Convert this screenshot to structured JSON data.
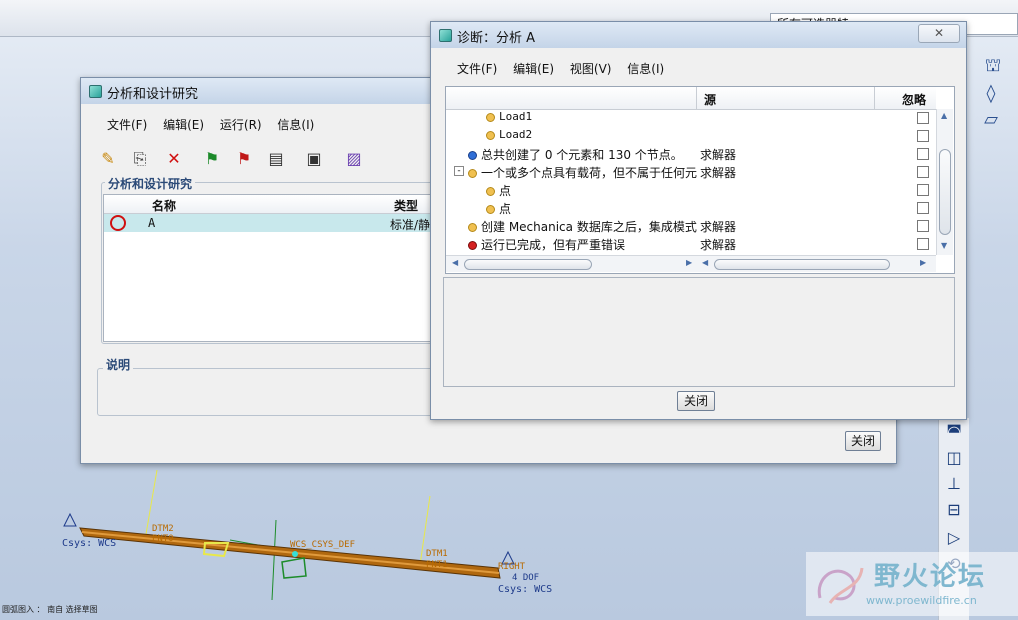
{
  "toolbar": {
    "filter_text": "所有可选器特"
  },
  "analysis_window": {
    "title": "分析和设计研究",
    "menu": [
      "文件(F)",
      "编辑(E)",
      "运行(R)",
      "信息(I)"
    ],
    "group_title": "分析和设计研究",
    "columns": {
      "name": "名称",
      "type": "类型"
    },
    "row": {
      "name": "A",
      "type": "标准/静"
    },
    "desc_title": "说明",
    "close_label": "关闭"
  },
  "diag_window": {
    "title": "诊断：分析 A",
    "close_x": "✕",
    "menu": [
      "文件(F)",
      "编辑(E)",
      "视图(V)",
      "信息(I)"
    ],
    "columns": {
      "source": "源",
      "ignore": "忽略"
    },
    "rows": [
      {
        "text": "Load1",
        "source": ""
      },
      {
        "text": "Load2",
        "source": ""
      },
      {
        "text": "总共创建了 0 个元素和 130 个节点。",
        "source": "求解器"
      },
      {
        "text": "一个或多个点具有载荷，但不属于任何元",
        "source": "求解器"
      },
      {
        "text": "点",
        "source": ""
      },
      {
        "text": "点",
        "source": ""
      },
      {
        "text": "创建 Mechanica 数据库之后，集成模式",
        "source": "求解器"
      },
      {
        "text": "运行已完成，但有严重错误",
        "source": "求解器"
      }
    ],
    "close_label": "关闭"
  },
  "canvas": {
    "labels": {
      "left_text": "Csys: WCS",
      "dtm2": "DTM2",
      "pnt0": "PNT0",
      "wcs": "WCS_CSYS_DEF",
      "dtm1": "DTM1",
      "pnt1": "PNT1",
      "right_dof": "RIGHT",
      "right_dof2": "4 DOF",
      "right_csys": "Csys: WCS"
    },
    "status": "圆弧图入 ： 南自 选择草图"
  },
  "watermark": {
    "title": "野火论坛",
    "url": "www.proewildfire.cn"
  }
}
